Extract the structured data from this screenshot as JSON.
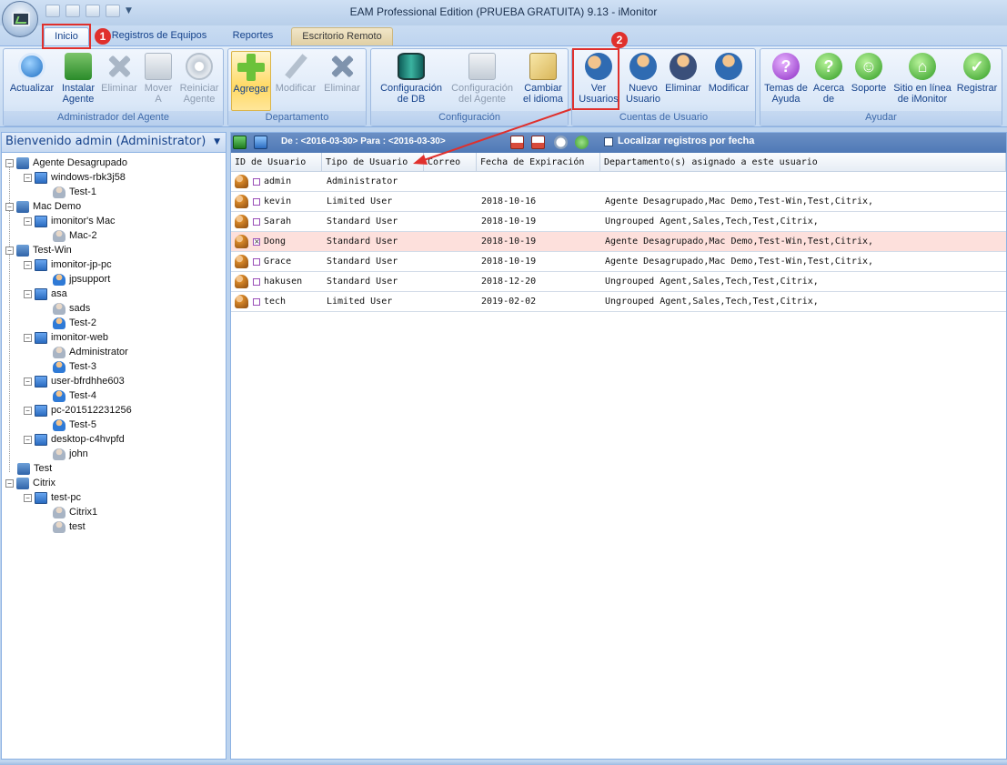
{
  "window": {
    "title": "EAM Professional Edition (PRUEBA GRATUITA) 9.13 - iMonitor"
  },
  "tabs": [
    {
      "label": "Inicio"
    },
    {
      "label": "Registros de Equipos"
    },
    {
      "label": "Reportes"
    },
    {
      "label": "Escritorio Remoto"
    }
  ],
  "ribbon": {
    "agent_group": {
      "label": "Administrador del Agente",
      "refresh": [
        "Actualizar"
      ],
      "install": [
        "Instalar",
        "Agente"
      ],
      "delete": [
        "Eliminar"
      ],
      "move": [
        "Mover",
        "A"
      ],
      "restart": [
        "Reiniciar",
        "Agente"
      ]
    },
    "dept_group": {
      "label": "Departamento",
      "add": [
        "Agregar"
      ],
      "modify": [
        "Modificar"
      ],
      "delete": [
        "Eliminar"
      ]
    },
    "config_group": {
      "label": "Configuración",
      "db": [
        "Configuración",
        "de DB"
      ],
      "agent": [
        "Configuración",
        "del Agente"
      ],
      "lang": [
        "Cambiar",
        "el idioma"
      ]
    },
    "users_group": {
      "label": "Cuentas de Usuario",
      "view": [
        "Ver",
        "Usuarios"
      ],
      "new": [
        "Nuevo",
        "Usuario"
      ],
      "delete": [
        "Eliminar"
      ],
      "modify": [
        "Modificar"
      ]
    },
    "help_group": {
      "label": "Ayudar",
      "topics": [
        "Temas de",
        "Ayuda"
      ],
      "about": [
        "Acerca",
        "de"
      ],
      "support": [
        "Soporte"
      ],
      "site": [
        "Sitio en línea",
        "de iMonitor"
      ],
      "register": [
        "Registrar"
      ]
    }
  },
  "annotations": {
    "marker1": "1",
    "marker2": "2"
  },
  "left_panel": {
    "header": "Bienvenido admin (Administrator)",
    "tree": [
      {
        "label": "Agente Desagrupado"
      },
      {
        "label": "windows-rbk3j58"
      },
      {
        "label": "Test-1"
      },
      {
        "label": "Mac Demo"
      },
      {
        "label": "imonitor's Mac"
      },
      {
        "label": "Mac-2"
      },
      {
        "label": "Test-Win"
      },
      {
        "label": "imonitor-jp-pc"
      },
      {
        "label": "jpsupport"
      },
      {
        "label": "asa"
      },
      {
        "label": "sads"
      },
      {
        "label": "Test-2"
      },
      {
        "label": "imonitor-web"
      },
      {
        "label": "Administrator"
      },
      {
        "label": "Test-3"
      },
      {
        "label": "user-bfrdhhe603"
      },
      {
        "label": "Test-4"
      },
      {
        "label": "pc-201512231256"
      },
      {
        "label": "Test-5"
      },
      {
        "label": "desktop-c4hvpfd"
      },
      {
        "label": "john"
      },
      {
        "label": "Test"
      },
      {
        "label": "Citrix"
      },
      {
        "label": "test-pc"
      },
      {
        "label": "Citrix1"
      },
      {
        "label": "test"
      }
    ]
  },
  "filter_bar": {
    "range": "De : <2016-03-30> Para : <2016-03-30>",
    "locate_label": "Localizar registros por fecha"
  },
  "grid": {
    "headers": [
      "ID de Usuario",
      "Tipo de Usuario",
      "Correo",
      "Fecha de Expiración",
      "Departamento(s) asignado a este usuario"
    ],
    "rows": [
      {
        "id": "admin",
        "type": "Administrator",
        "email": "",
        "expires": "",
        "depts": ""
      },
      {
        "id": "kevin",
        "type": "Limited User",
        "email": "",
        "expires": "2018-10-16",
        "depts": "Agente Desagrupado,Mac Demo,Test-Win,Test,Citrix,"
      },
      {
        "id": "Sarah",
        "type": "Standard User",
        "email": "",
        "expires": "2018-10-19",
        "depts": "Ungrouped Agent,Sales,Tech,Test,Citrix,"
      },
      {
        "id": "Dong",
        "type": "Standard User",
        "email": "",
        "expires": "2018-10-19",
        "depts": "Agente Desagrupado,Mac Demo,Test-Win,Test,Citrix,"
      },
      {
        "id": "Grace",
        "type": "Standard User",
        "email": "",
        "expires": "2018-10-19",
        "depts": "Agente Desagrupado,Mac Demo,Test-Win,Test,Citrix,"
      },
      {
        "id": "hakusen",
        "type": "Standard User",
        "email": "",
        "expires": "2018-12-20",
        "depts": "Ungrouped Agent,Sales,Tech,Test,Citrix,"
      },
      {
        "id": "tech",
        "type": "Limited User",
        "email": "",
        "expires": "2019-02-02",
        "depts": "Ungrouped Agent,Sales,Tech,Test,Citrix,"
      }
    ]
  },
  "colors": {
    "highlight": "#e0302c",
    "selected_row": "#fde0dc",
    "ribbon_text": "#15428b"
  }
}
